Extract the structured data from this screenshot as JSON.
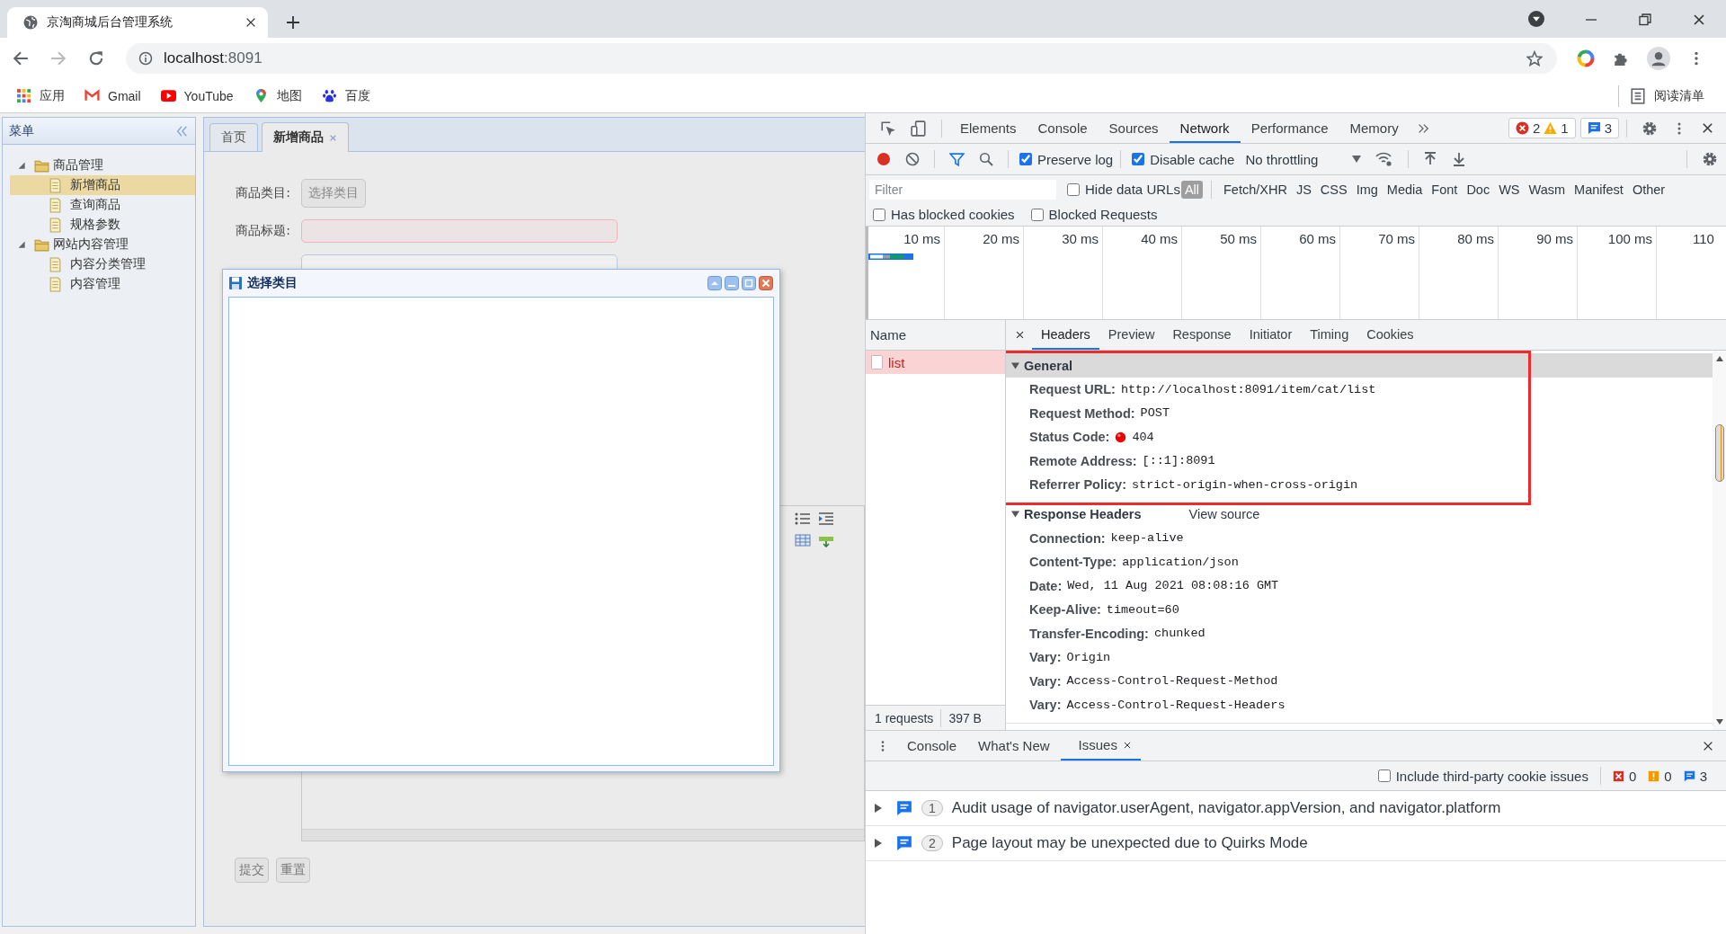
{
  "browser": {
    "tab_title": "京淘商城后台管理系统",
    "url_host": "localhost",
    "url_port": ":8091",
    "bookmarks": [
      {
        "kind": "apps",
        "label": "应用"
      },
      {
        "kind": "mail",
        "label": "Gmail"
      },
      {
        "kind": "video",
        "label": "YouTube"
      },
      {
        "kind": "map",
        "label": "地图"
      },
      {
        "kind": "paw",
        "label": "百度"
      }
    ],
    "reading_list": "阅读清单"
  },
  "app": {
    "sidebar": {
      "title": "菜单",
      "tree": [
        {
          "label": "商品管理",
          "expanded": true,
          "children": [
            {
              "label": "新增商品",
              "selected": true
            },
            {
              "label": "查询商品",
              "selected": false
            },
            {
              "label": "规格参数",
              "selected": false
            }
          ]
        },
        {
          "label": "网站内容管理",
          "expanded": true,
          "children": [
            {
              "label": "内容分类管理",
              "selected": false
            },
            {
              "label": "内容管理",
              "selected": false
            }
          ]
        }
      ]
    },
    "tabs": [
      {
        "label": "首页",
        "selected": false,
        "closable": false
      },
      {
        "label": "新增商品",
        "selected": true,
        "closable": true
      }
    ],
    "form": {
      "fields": [
        {
          "kind": "button",
          "label": "商品类目:",
          "value": "选择类目"
        },
        {
          "kind": "input",
          "label": "商品标题:",
          "invalid": true
        },
        {
          "kind": "input",
          "invalid": false
        },
        {
          "kind": "editor"
        }
      ],
      "buttons": [
        "提交",
        "重置"
      ]
    },
    "dialog": {
      "title": "选择类目"
    }
  },
  "devtools": {
    "panels": [
      {
        "label": "Elements",
        "selected": false
      },
      {
        "label": "Console",
        "selected": false
      },
      {
        "label": "Sources",
        "selected": false
      },
      {
        "label": "Network",
        "selected": true
      },
      {
        "label": "Performance",
        "selected": false
      },
      {
        "label": "Memory",
        "selected": false
      }
    ],
    "issue_counts": {
      "errors": "2",
      "warnings": "1",
      "messages": "3"
    },
    "toolbar": {
      "options": [
        {
          "label": "Preserve log",
          "checked": true
        },
        {
          "label": "Disable cache",
          "checked": true
        }
      ],
      "throttling": "No throttling"
    },
    "filter": {
      "placeholder": "Filter",
      "hide_data_urls": {
        "label": "Hide data URLs",
        "checked": false
      },
      "types": [
        {
          "label": "All",
          "selected": true
        },
        {
          "label": "Fetch/XHR",
          "selected": false
        },
        {
          "label": "JS",
          "selected": false
        },
        {
          "label": "CSS",
          "selected": false
        },
        {
          "label": "Img",
          "selected": false
        },
        {
          "label": "Media",
          "selected": false
        },
        {
          "label": "Font",
          "selected": false
        },
        {
          "label": "Doc",
          "selected": false
        },
        {
          "label": "WS",
          "selected": false
        },
        {
          "label": "Wasm",
          "selected": false
        },
        {
          "label": "Manifest",
          "selected": false
        },
        {
          "label": "Other",
          "selected": false
        }
      ],
      "options": [
        {
          "label": "Has blocked cookies",
          "checked": false
        },
        {
          "label": "Blocked Requests",
          "checked": false
        }
      ]
    },
    "timeline": {
      "ticks": [
        "10 ms",
        "20 ms",
        "30 ms",
        "40 ms",
        "50 ms",
        "60 ms",
        "70 ms",
        "80 ms",
        "90 ms",
        "100 ms",
        "110"
      ]
    },
    "requests": {
      "column": "Name",
      "rows": [
        {
          "name": "list",
          "failed": true,
          "selected": true
        }
      ],
      "summary": [
        "1 requests",
        "397 B"
      ]
    },
    "details": {
      "tabs": [
        {
          "label": "Headers",
          "selected": true
        },
        {
          "label": "Preview",
          "selected": false
        },
        {
          "label": "Response",
          "selected": false
        },
        {
          "label": "Initiator",
          "selected": false
        },
        {
          "label": "Timing",
          "selected": false
        },
        {
          "label": "Cookies",
          "selected": false
        }
      ],
      "sections": [
        {
          "title": "General",
          "expanded": true,
          "highlighted": true,
          "rows": [
            {
              "key": "Request URL:",
              "value": "http://localhost:8091/item/cat/list"
            },
            {
              "key": "Request Method:",
              "value": "POST"
            },
            {
              "key": "Status Code:",
              "value": "404",
              "failed": true
            },
            {
              "key": "Remote Address:",
              "value": "[::1]:8091"
            },
            {
              "key": "Referrer Policy:",
              "value": "strict-origin-when-cross-origin"
            }
          ]
        },
        {
          "title": "Response Headers",
          "expanded": true,
          "highlighted": false,
          "link": "View source",
          "rows": [
            {
              "key": "Connection:",
              "value": "keep-alive"
            },
            {
              "key": "Content-Type:",
              "value": "application/json"
            },
            {
              "key": "Date:",
              "value": "Wed, 11 Aug 2021 08:08:16 GMT"
            },
            {
              "key": "Keep-Alive:",
              "value": "timeout=60"
            },
            {
              "key": "Transfer-Encoding:",
              "value": "chunked"
            },
            {
              "key": "Vary:",
              "value": "Origin"
            },
            {
              "key": "Vary:",
              "value": "Access-Control-Request-Method"
            },
            {
              "key": "Vary:",
              "value": "Access-Control-Request-Headers"
            }
          ]
        }
      ]
    },
    "drawer": {
      "tabs": [
        {
          "label": "Console",
          "selected": false,
          "closable": false
        },
        {
          "label": "What's New",
          "selected": false,
          "closable": false
        },
        {
          "label": "Issues",
          "selected": true,
          "closable": true
        }
      ],
      "third_party": {
        "label": "Include third-party cookie issues",
        "checked": false
      },
      "counts": {
        "errors": "0",
        "warnings": "0",
        "info": "3"
      },
      "issues": [
        {
          "count": "1",
          "text": "Audit usage of navigator.userAgent, navigator.appVersion, and navigator.platform"
        },
        {
          "count": "2",
          "text": "Page layout may be unexpected due to Quirks Mode"
        }
      ]
    }
  }
}
